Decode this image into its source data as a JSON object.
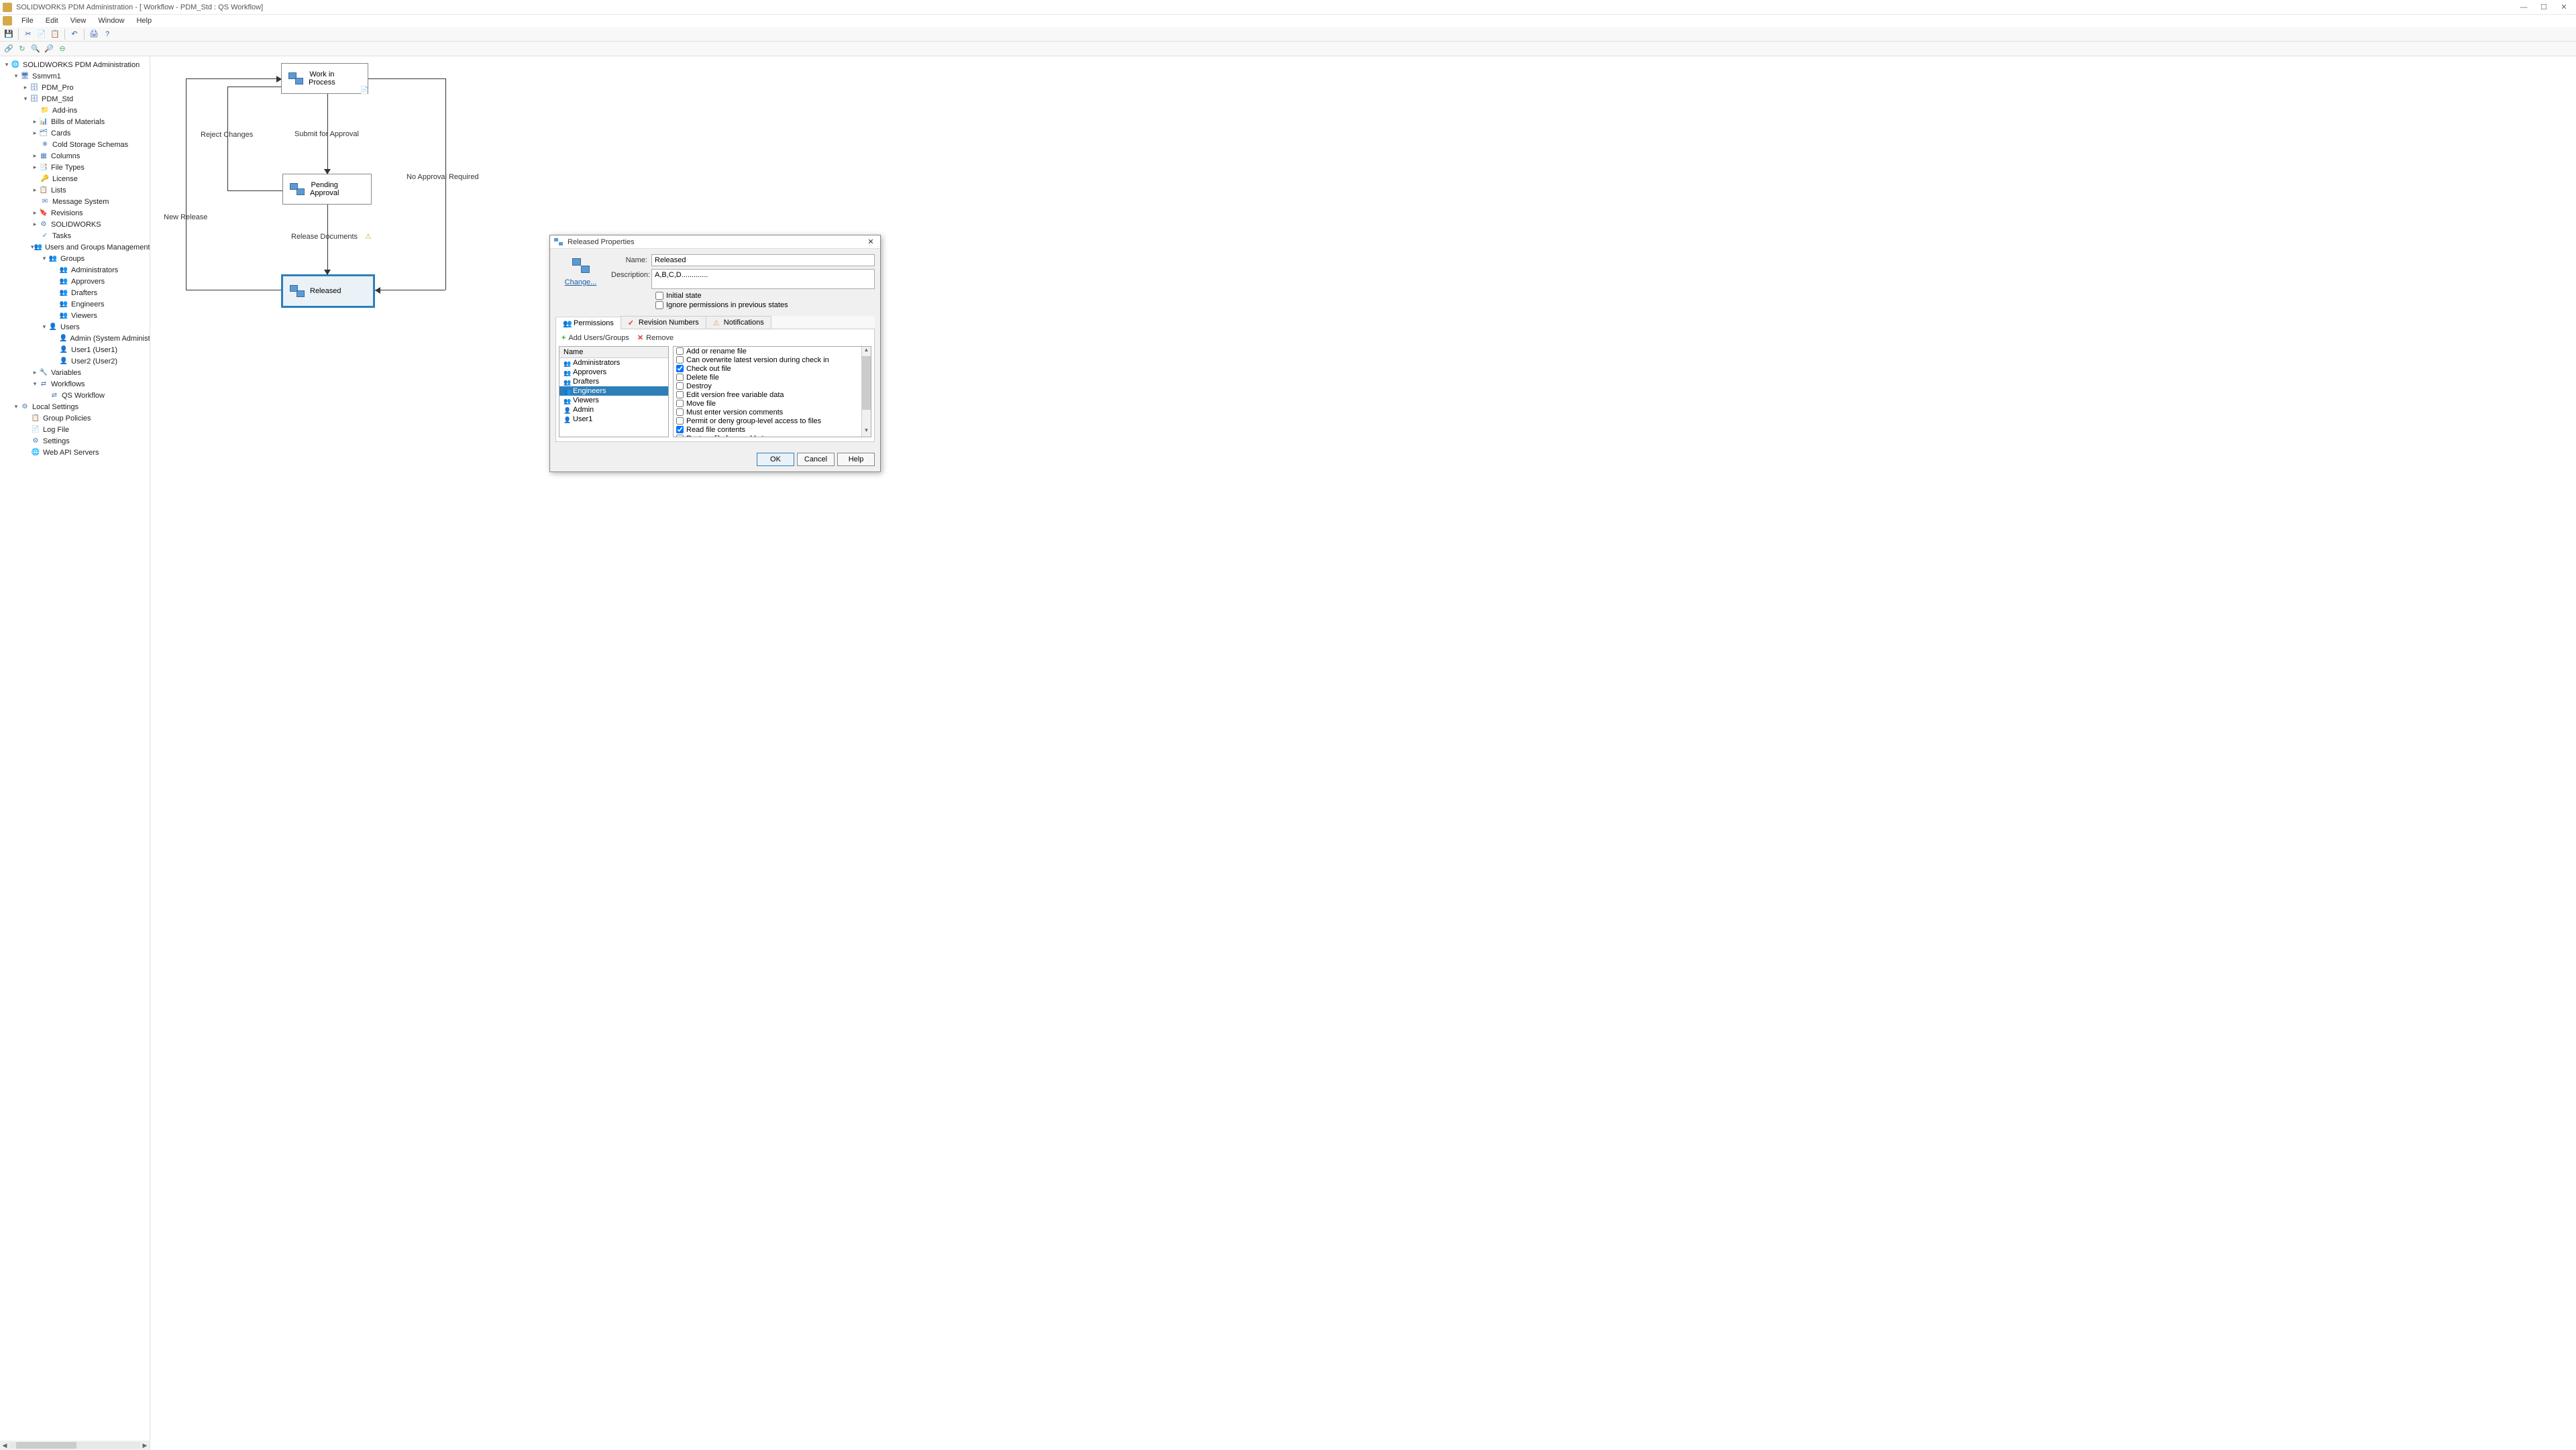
{
  "titlebar": {
    "title": "SOLIDWORKS PDM Administration - [ Workflow - PDM_Std : QS Workflow]"
  },
  "menus": [
    "File",
    "Edit",
    "View",
    "Window",
    "Help"
  ],
  "tree": {
    "root": "SOLIDWORKS PDM Administration",
    "server": "Ssmvm1",
    "vaults": [
      "PDM_Pro",
      "PDM_Std"
    ],
    "stdItems": [
      "Add-ins",
      "Bills of Materials",
      "Cards",
      "Cold Storage Schemas",
      "Columns",
      "File Types",
      "License",
      "Lists",
      "Message System",
      "Revisions",
      "SOLIDWORKS",
      "Tasks",
      "Users and Groups Management"
    ],
    "groups": [
      "Administrators",
      "Approvers",
      "Drafters",
      "Engineers",
      "Viewers"
    ],
    "users": [
      "Admin (System Administrator)",
      "User1 (User1)",
      "User2 (User2)"
    ],
    "afterUG": [
      "Variables",
      "Workflows"
    ],
    "workflow": "QS Workflow",
    "local": "Local Settings",
    "localItems": [
      "Group Policies",
      "Log File",
      "Settings",
      "Web API Servers"
    ],
    "groupsLabel": "Groups",
    "usersLabel": "Users"
  },
  "workflow": {
    "nodes": {
      "wip": "Work in\nProcess",
      "pending": "Pending\nApproval",
      "released": "Released"
    },
    "labels": {
      "reject": "Reject Changes",
      "submit": "Submit for Approval",
      "newrel": "New Release",
      "reldocs": "Release Documents",
      "noapprov": "No Approval Required"
    }
  },
  "dialog": {
    "title": "Released Properties",
    "nameLabel": "Name:",
    "nameValue": "Released",
    "descLabel": "Description:",
    "descValue": "A,B,C,D.............",
    "changeLink": "Change...",
    "initialState": "Initial state",
    "ignorePerms": "Ignore permissions in previous states",
    "tabs": [
      "Permissions",
      "Revision Numbers",
      "Notifications"
    ],
    "addUsers": "Add Users/Groups",
    "remove": "Remove",
    "nameCol": "Name",
    "nameList": [
      {
        "name": "Administrators",
        "type": "grp"
      },
      {
        "name": "Approvers",
        "type": "grp"
      },
      {
        "name": "Drafters",
        "type": "grp"
      },
      {
        "name": "Engineers",
        "type": "grp",
        "selected": true
      },
      {
        "name": "Viewers",
        "type": "grp"
      },
      {
        "name": "Admin",
        "type": "usr"
      },
      {
        "name": "User1",
        "type": "usr"
      }
    ],
    "permissions": [
      {
        "label": "Add or rename file",
        "checked": false
      },
      {
        "label": "Can overwrite latest version during check in",
        "checked": false
      },
      {
        "label": "Check out file",
        "checked": true
      },
      {
        "label": "Delete file",
        "checked": false
      },
      {
        "label": "Destroy",
        "checked": false
      },
      {
        "label": "Edit version free variable data",
        "checked": false
      },
      {
        "label": "Move file",
        "checked": false
      },
      {
        "label": "Must enter version comments",
        "checked": false
      },
      {
        "label": "Permit or deny group-level access to files",
        "checked": false
      },
      {
        "label": "Read file contents",
        "checked": true
      },
      {
        "label": "Restore file from cold storage",
        "checked": false
      }
    ],
    "buttons": {
      "ok": "OK",
      "cancel": "Cancel",
      "help": "Help"
    }
  }
}
